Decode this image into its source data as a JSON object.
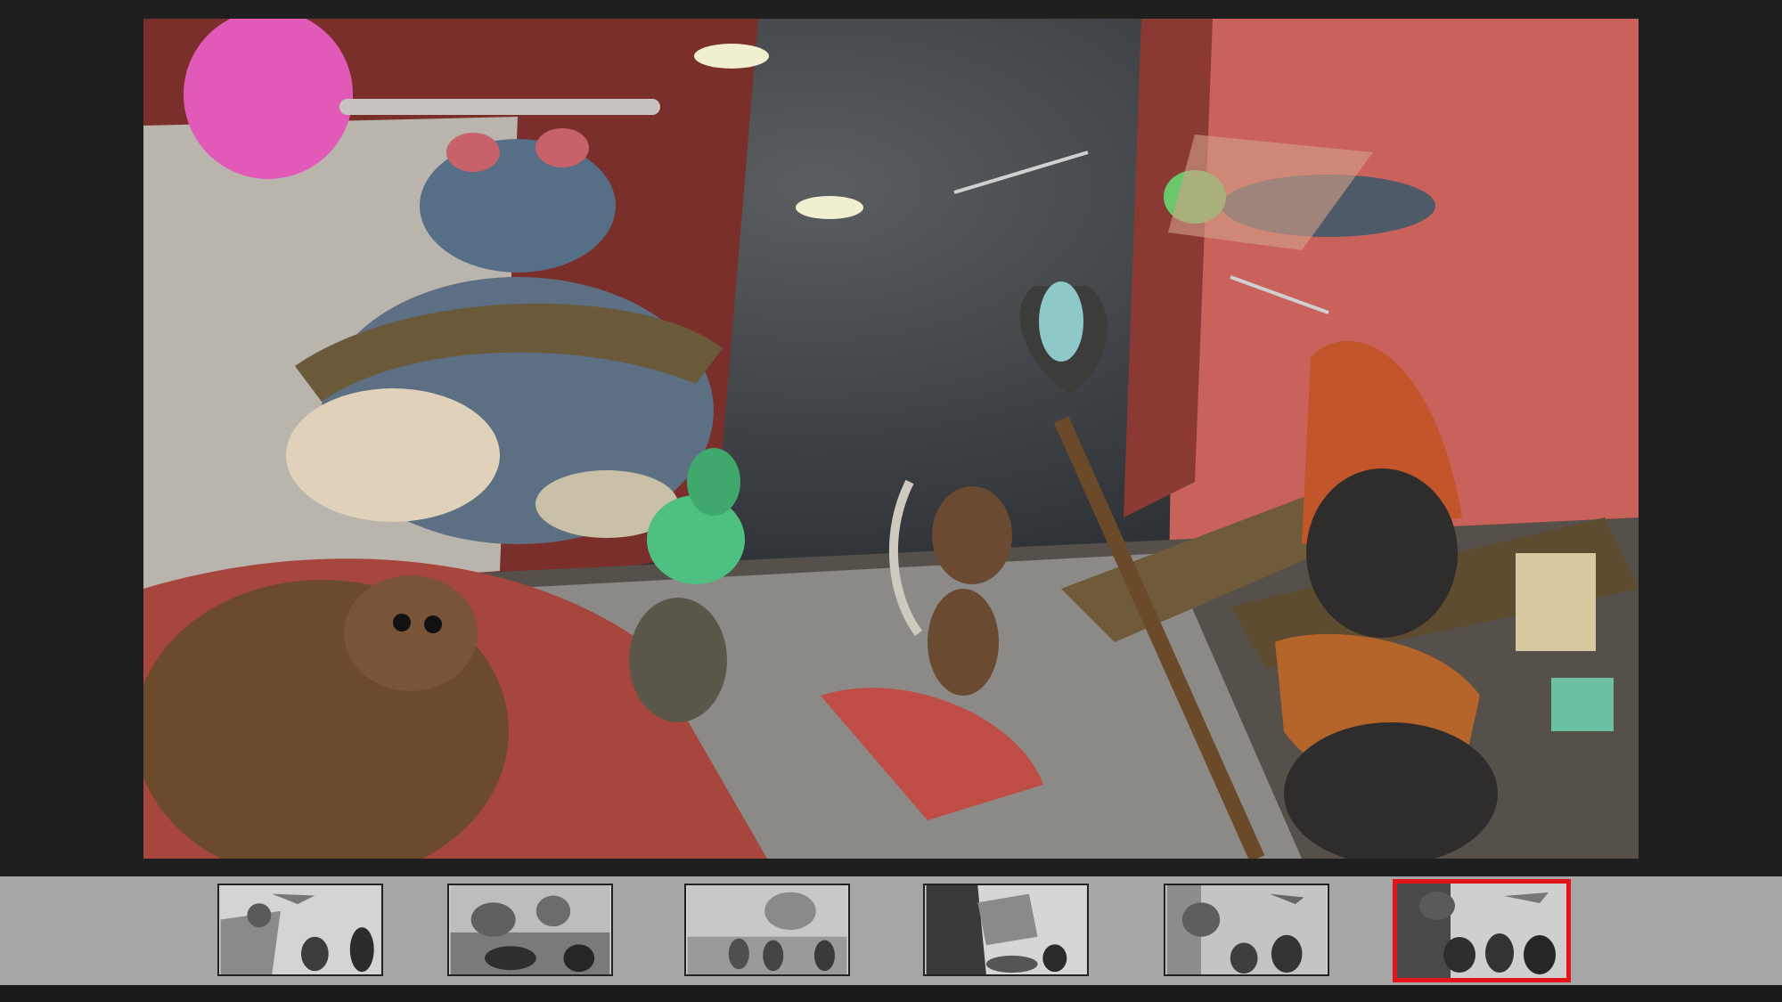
{
  "viewer": {
    "selected_index": 5,
    "thumbnail_count": 6
  },
  "main_image": {
    "icon": "fantasy-bug-battle-painting"
  },
  "colors": {
    "background": "#1f1f1f",
    "filmstrip": "#a6a6a6",
    "selection_border": "#e3141a"
  },
  "thumbnails": [
    {
      "icon": "storyboard-thumbnail-1"
    },
    {
      "icon": "storyboard-thumbnail-2"
    },
    {
      "icon": "storyboard-thumbnail-3"
    },
    {
      "icon": "storyboard-thumbnail-4"
    },
    {
      "icon": "storyboard-thumbnail-5"
    },
    {
      "icon": "storyboard-thumbnail-6"
    }
  ]
}
